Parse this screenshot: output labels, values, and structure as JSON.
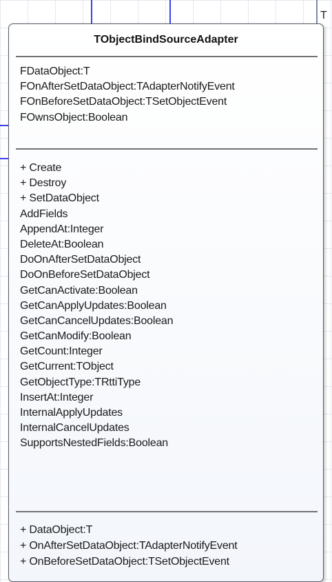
{
  "edge_label": "T",
  "class": {
    "name": "TObjectBindSourceAdapter",
    "fields": [
      "FDataObject:T",
      "FOnAfterSetDataObject:TAdapterNotifyEvent",
      "FOnBeforeSetDataObject:TSetObjectEvent",
      "FOwnsObject:Boolean"
    ],
    "methods": [
      "+ Create",
      "+ Destroy",
      "+ SetDataObject",
      "AddFields",
      "AppendAt:Integer",
      "DeleteAt:Boolean",
      "DoOnAfterSetDataObject",
      "DoOnBeforeSetDataObject",
      "GetCanActivate:Boolean",
      "GetCanApplyUpdates:Boolean",
      "GetCanCancelUpdates:Boolean",
      "GetCanModify:Boolean",
      "GetCount:Integer",
      "GetCurrent:TObject",
      "GetObjectType:TRttiType",
      "InsertAt:Integer",
      "InternalApplyUpdates",
      "InternalCancelUpdates",
      "SupportsNestedFields:Boolean"
    ],
    "properties": [
      "+ DataObject:T",
      "+ OnAfterSetDataObject:TAdapterNotifyEvent",
      "+ OnBeforeSetDataObject:TSetObjectEvent"
    ]
  },
  "colors": {
    "connector": "#3c3cf0",
    "grid": "#e3e8f0",
    "box_border": "#555a66",
    "separator": "#707070"
  }
}
